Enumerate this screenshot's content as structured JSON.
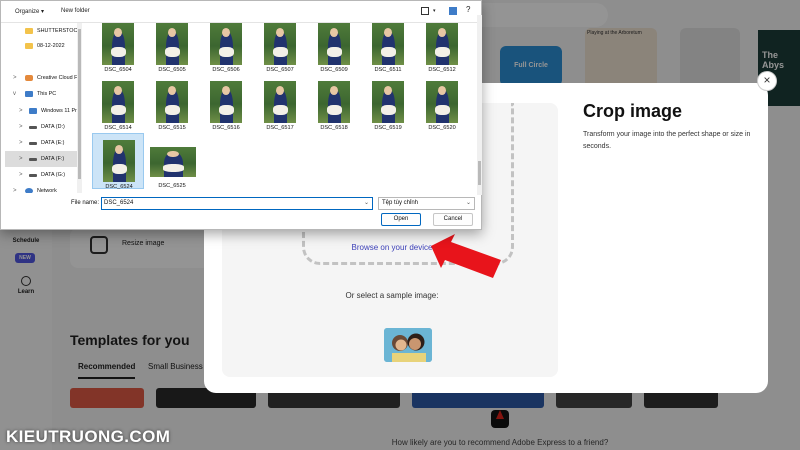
{
  "background": {
    "rail": {
      "schedule_label": "Schedule",
      "new_badge": "NEW",
      "learn_label": "Learn"
    },
    "resize_card_label": "Resize image",
    "full_circle_label": "Full Circle",
    "playing_label": "Playing at the Arboretum",
    "book_label": "The Abys",
    "templates_title": "Templates for you",
    "tabs": [
      "Recommended",
      "Small Business"
    ],
    "survey_text": "How likely are you to recommend Adobe Express to a friend?"
  },
  "crop_modal": {
    "title": "Crop image",
    "description": "Transform your image into the perfect shape or size in seconds.",
    "browse_link": "Browse on your device",
    "sample_label": "Or select a sample image:",
    "close_symbol": "×"
  },
  "file_dialog": {
    "toolbar": {
      "organize": "Organize ▾",
      "new_folder": "New folder"
    },
    "nav": [
      {
        "label": "SHUTTERSTOCK",
        "icon": "folder",
        "chevron": ""
      },
      {
        "label": "08-12-2022",
        "icon": "folder",
        "chevron": ""
      },
      {
        "label": "Creative Cloud F",
        "icon": "cloud",
        "chevron": ">"
      },
      {
        "label": "This PC",
        "icon": "pc",
        "chevron": "v"
      },
      {
        "label": "Windows 11 Pr",
        "icon": "pc",
        "chevron": ">"
      },
      {
        "label": "DATA (D:)",
        "icon": "drive",
        "chevron": ">"
      },
      {
        "label": "DATA (E:)",
        "icon": "drive",
        "chevron": ">"
      },
      {
        "label": "DATA (F:)",
        "icon": "drive",
        "chevron": ">"
      },
      {
        "label": "DATA (G:)",
        "icon": "drive",
        "chevron": ">"
      },
      {
        "label": "Network",
        "icon": "net",
        "chevron": ">"
      }
    ],
    "files": [
      "DSC_6504",
      "DSC_6505",
      "DSC_6506",
      "DSC_6507",
      "DSC_6509",
      "DSC_6511",
      "DSC_6512",
      "DSC_6514",
      "DSC_6515",
      "DSC_6516",
      "DSC_6517",
      "DSC_6518",
      "DSC_6519",
      "DSC_6520",
      "DSC_6524",
      "DSC_6525"
    ],
    "selected_file": "DSC_6524",
    "filename_label": "File name:",
    "filename_value": "DSC_6524",
    "filetype_value": "Tệp tùy chỉnh",
    "open_button": "Open",
    "cancel_button": "Cancel"
  },
  "watermark": "KIEUTRUONG.COM",
  "colors": {
    "accent": "#0067c0",
    "link": "#3b3fb8",
    "arrow": "#e8141b",
    "selection": "#cce4f7"
  }
}
